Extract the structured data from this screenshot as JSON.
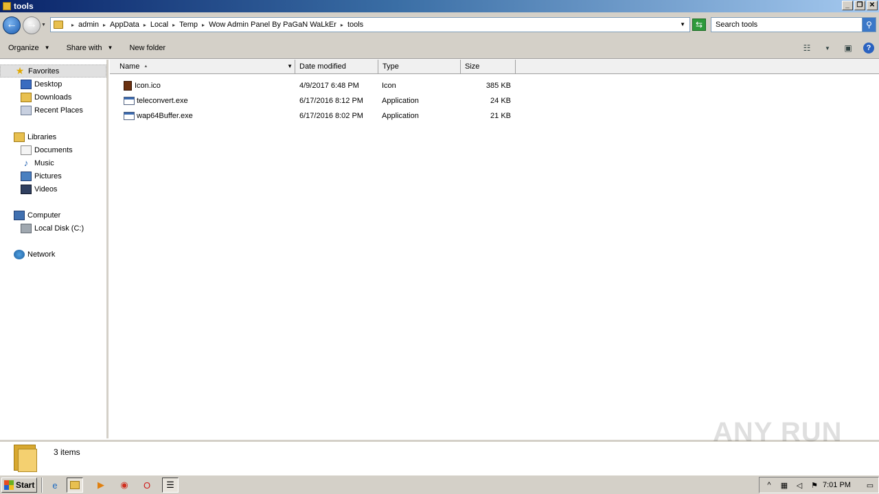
{
  "window": {
    "title": "tools"
  },
  "address": {
    "crumbs": [
      "admin",
      "AppData",
      "Local",
      "Temp",
      "Wow Admin Panel By PaGaN WaLkEr",
      "tools"
    ]
  },
  "search": {
    "placeholder": "Search tools"
  },
  "toolbar": {
    "organize": "Organize",
    "share_with": "Share with",
    "new_folder": "New folder"
  },
  "nav": {
    "favorites": {
      "label": "Favorites",
      "items": [
        "Desktop",
        "Downloads",
        "Recent Places"
      ]
    },
    "libraries": {
      "label": "Libraries",
      "items": [
        "Documents",
        "Music",
        "Pictures",
        "Videos"
      ]
    },
    "computer": {
      "label": "Computer",
      "items": [
        "Local Disk (C:)"
      ]
    },
    "network": {
      "label": "Network"
    }
  },
  "columns": {
    "name": "Name",
    "date": "Date modified",
    "type": "Type",
    "size": "Size"
  },
  "files": [
    {
      "name": "Icon.ico",
      "date": "4/9/2017 6:48 PM",
      "type": "Icon",
      "size": "385 KB",
      "icon": "ico-file-icon"
    },
    {
      "name": "teleconvert.exe",
      "date": "6/17/2016 8:12 PM",
      "type": "Application",
      "size": "24 KB",
      "icon": "exe-file-icon"
    },
    {
      "name": "wap64Buffer.exe",
      "date": "6/17/2016 8:02 PM",
      "type": "Application",
      "size": "21 KB",
      "icon": "exe-file-icon"
    }
  ],
  "details": {
    "count": "3 items"
  },
  "watermark": "ANY RUN",
  "taskbar": {
    "start": "Start",
    "clock": "7:01 PM"
  }
}
